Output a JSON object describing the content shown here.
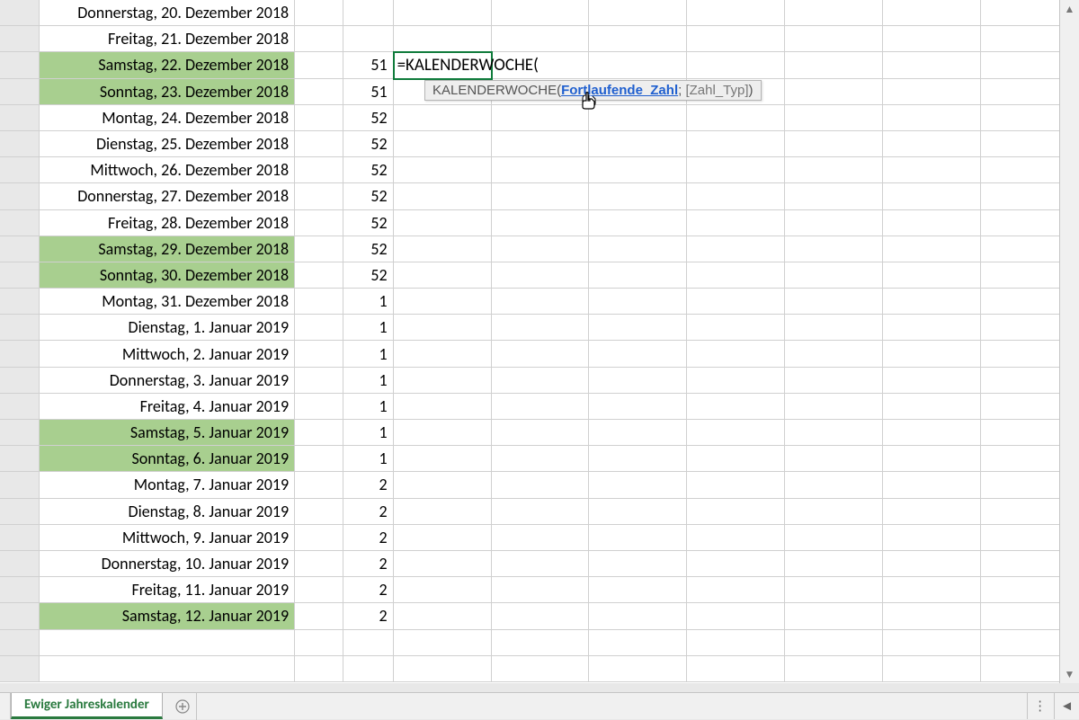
{
  "rows": [
    {
      "date": "Donnerstag, 20. Dezember 2018",
      "week": "",
      "weekend": false
    },
    {
      "date": "Freitag, 21. Dezember 2018",
      "week": "",
      "weekend": false
    },
    {
      "date": "Samstag, 22. Dezember 2018",
      "week": "51",
      "weekend": true,
      "editing": true,
      "formula": "=KALENDERWOCHE("
    },
    {
      "date": "Sonntag, 23. Dezember 2018",
      "week": "51",
      "weekend": true
    },
    {
      "date": "Montag, 24. Dezember 2018",
      "week": "52",
      "weekend": false
    },
    {
      "date": "Dienstag, 25. Dezember 2018",
      "week": "52",
      "weekend": false
    },
    {
      "date": "Mittwoch, 26. Dezember 2018",
      "week": "52",
      "weekend": false
    },
    {
      "date": "Donnerstag, 27. Dezember 2018",
      "week": "52",
      "weekend": false
    },
    {
      "date": "Freitag, 28. Dezember 2018",
      "week": "52",
      "weekend": false
    },
    {
      "date": "Samstag, 29. Dezember 2018",
      "week": "52",
      "weekend": true
    },
    {
      "date": "Sonntag, 30. Dezember 2018",
      "week": "52",
      "weekend": true
    },
    {
      "date": "Montag, 31. Dezember 2018",
      "week": "1",
      "weekend": false
    },
    {
      "date": "Dienstag, 1. Januar 2019",
      "week": "1",
      "weekend": false
    },
    {
      "date": "Mittwoch, 2. Januar 2019",
      "week": "1",
      "weekend": false
    },
    {
      "date": "Donnerstag, 3. Januar 2019",
      "week": "1",
      "weekend": false
    },
    {
      "date": "Freitag, 4. Januar 2019",
      "week": "1",
      "weekend": false
    },
    {
      "date": "Samstag, 5. Januar 2019",
      "week": "1",
      "weekend": true
    },
    {
      "date": "Sonntag, 6. Januar 2019",
      "week": "1",
      "weekend": true
    },
    {
      "date": "Montag, 7. Januar 2019",
      "week": "2",
      "weekend": false
    },
    {
      "date": "Dienstag, 8. Januar 2019",
      "week": "2",
      "weekend": false
    },
    {
      "date": "Mittwoch, 9. Januar 2019",
      "week": "2",
      "weekend": false
    },
    {
      "date": "Donnerstag, 10. Januar 2019",
      "week": "2",
      "weekend": false
    },
    {
      "date": "Freitag, 11. Januar 2019",
      "week": "2",
      "weekend": false
    },
    {
      "date": "Samstag, 12. Januar 2019",
      "week": "2",
      "weekend": true
    },
    {
      "date": "",
      "week": "",
      "weekend": false
    },
    {
      "date": "",
      "week": "",
      "weekend": false
    }
  ],
  "tooltip": {
    "fn": "KALENDERWOCHE(",
    "arg_active": "Fortlaufende_Zahl",
    "sep": "; ",
    "arg_optional": "[Zahl_Typ]",
    "close": ")"
  },
  "sheet": {
    "tab": "Ewiger Jahreskalender"
  },
  "extra_cols": 6
}
